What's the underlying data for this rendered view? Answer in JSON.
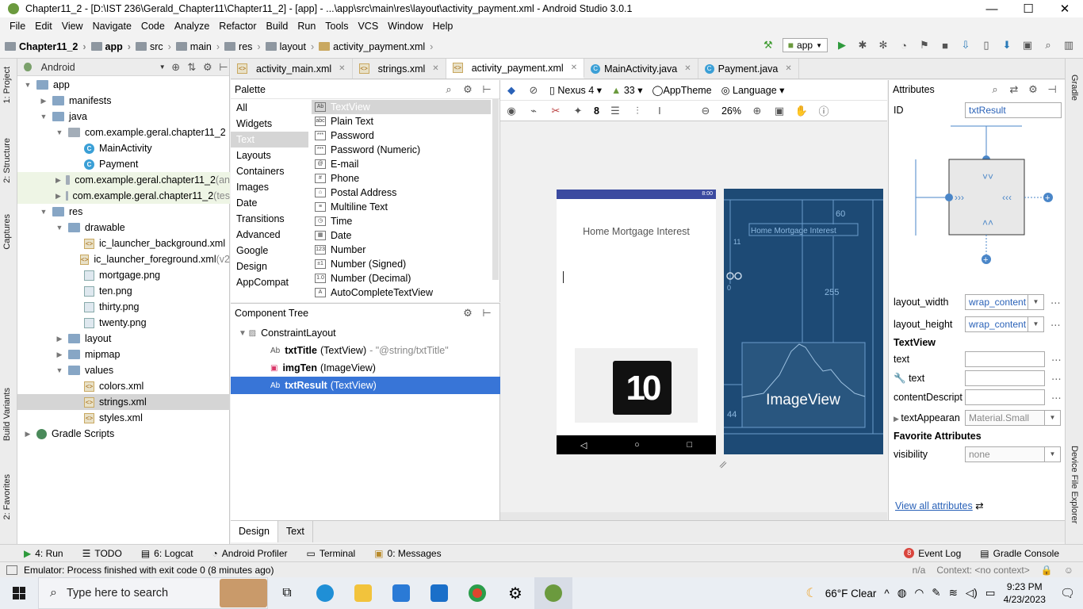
{
  "window": {
    "title": "Chapter11_2 - [D:\\IST 236\\Gerald_Chapter11\\Chapter11_2] - [app] - ...\\app\\src\\main\\res\\layout\\activity_payment.xml - Android Studio 3.0.1",
    "minimize": "—",
    "maximize": "☐",
    "close": "✕"
  },
  "menu": [
    "File",
    "Edit",
    "View",
    "Navigate",
    "Code",
    "Analyze",
    "Refactor",
    "Build",
    "Run",
    "Tools",
    "VCS",
    "Window",
    "Help"
  ],
  "breadcrumbs": [
    "Chapter11_2",
    "app",
    "src",
    "main",
    "res",
    "layout",
    "activity_payment.xml"
  ],
  "run_config": "app",
  "project_panel": {
    "view": "Android",
    "tree": [
      {
        "label": "app",
        "depth": 0,
        "kind": "folder",
        "open": true
      },
      {
        "label": "manifests",
        "depth": 1,
        "kind": "folder",
        "open": false
      },
      {
        "label": "java",
        "depth": 1,
        "kind": "folder",
        "open": true
      },
      {
        "label": "com.example.geral.chapter11_2",
        "depth": 2,
        "kind": "pkg",
        "open": true
      },
      {
        "label": "MainActivity",
        "depth": 3,
        "kind": "class"
      },
      {
        "label": "Payment",
        "depth": 3,
        "kind": "class"
      },
      {
        "label": "com.example.geral.chapter11_2",
        "suffix": " (an",
        "depth": 2,
        "kind": "pkg",
        "open": false
      },
      {
        "label": "com.example.geral.chapter11_2",
        "suffix": " (tes",
        "depth": 2,
        "kind": "pkg",
        "open": false
      },
      {
        "label": "res",
        "depth": 1,
        "kind": "folder",
        "open": true
      },
      {
        "label": "drawable",
        "depth": 2,
        "kind": "folder",
        "open": true
      },
      {
        "label": "ic_launcher_background.xml",
        "depth": 3,
        "kind": "xml"
      },
      {
        "label": "ic_launcher_foreground.xml",
        "suffix": " (v2",
        "depth": 3,
        "kind": "xml"
      },
      {
        "label": "mortgage.png",
        "depth": 3,
        "kind": "png"
      },
      {
        "label": "ten.png",
        "depth": 3,
        "kind": "png"
      },
      {
        "label": "thirty.png",
        "depth": 3,
        "kind": "png"
      },
      {
        "label": "twenty.png",
        "depth": 3,
        "kind": "png"
      },
      {
        "label": "layout",
        "depth": 2,
        "kind": "folder",
        "open": false
      },
      {
        "label": "mipmap",
        "depth": 2,
        "kind": "folder",
        "open": false
      },
      {
        "label": "values",
        "depth": 2,
        "kind": "folder",
        "open": true
      },
      {
        "label": "colors.xml",
        "depth": 3,
        "kind": "xml"
      },
      {
        "label": "strings.xml",
        "depth": 3,
        "kind": "xml",
        "selected": true
      },
      {
        "label": "styles.xml",
        "depth": 3,
        "kind": "xml"
      },
      {
        "label": "Gradle Scripts",
        "depth": 0,
        "kind": "gradle",
        "open": false
      }
    ]
  },
  "left_tabs": [
    "1: Project",
    "2: Structure",
    "Captures",
    "Build Variants",
    "2: Favorites"
  ],
  "right_tabs": [
    "Gradle",
    "Device File Explorer"
  ],
  "editor_tabs": [
    {
      "label": "activity_main.xml",
      "icon": "xml"
    },
    {
      "label": "strings.xml",
      "icon": "xml"
    },
    {
      "label": "activity_payment.xml",
      "icon": "xml",
      "active": true
    },
    {
      "label": "MainActivity.java",
      "icon": "class"
    },
    {
      "label": "Payment.java",
      "icon": "class"
    }
  ],
  "palette": {
    "title": "Palette",
    "categories": [
      "All",
      "Widgets",
      "Text",
      "Layouts",
      "Containers",
      "Images",
      "Date",
      "Transitions",
      "Advanced",
      "Google",
      "Design",
      "AppCompat"
    ],
    "selected_category": "Text",
    "items": [
      {
        "icon": "Ab",
        "label": "TextView"
      },
      {
        "icon": "abc",
        "label": "Plain Text"
      },
      {
        "icon": "***",
        "label": "Password"
      },
      {
        "icon": "***",
        "label": "Password (Numeric)"
      },
      {
        "icon": "@",
        "label": "E-mail"
      },
      {
        "icon": "#",
        "label": "Phone"
      },
      {
        "icon": "⌂",
        "label": "Postal Address"
      },
      {
        "icon": "≡",
        "label": "Multiline Text"
      },
      {
        "icon": "◷",
        "label": "Time"
      },
      {
        "icon": "▦",
        "label": "Date"
      },
      {
        "icon": "123",
        "label": "Number"
      },
      {
        "icon": "±1",
        "label": "Number (Signed)"
      },
      {
        "icon": "1.0",
        "label": "Number (Decimal)"
      },
      {
        "icon": "A",
        "label": "AutoCompleteTextView"
      }
    ]
  },
  "component_tree": {
    "title": "Component Tree",
    "rows": [
      {
        "name": "ConstraintLayout",
        "type": "",
        "hint": "",
        "depth": 0
      },
      {
        "name": "txtTitle",
        "type": "(TextView)",
        "hint": "- \"@string/txtTitle\"",
        "depth": 1
      },
      {
        "name": "imgTen",
        "type": "(ImageView)",
        "hint": "",
        "depth": 1
      },
      {
        "name": "txtResult",
        "type": "(TextView)",
        "hint": "",
        "depth": 1,
        "selected": true
      }
    ]
  },
  "surface_toolbar": {
    "device": "Nexus 4",
    "api": "33",
    "theme": "AppTheme",
    "language": "Language",
    "margin": "8",
    "zoom": "26%"
  },
  "phone": {
    "status_time": "8:00",
    "title_text": "Home Mortgage Interest",
    "image_text": "10"
  },
  "blueprint": {
    "title_text": "Home Mortgage Interest",
    "image_label": "ImageView",
    "dim_60": "60",
    "dim_255": "255",
    "dim_44": "44",
    "dim_11": "11",
    "dim_0": "0"
  },
  "attributes": {
    "title": "Attributes",
    "id_label": "ID",
    "id_value": "txtResult",
    "layout_width_label": "layout_width",
    "layout_width": "wrap_content",
    "layout_height_label": "layout_height",
    "layout_height": "wrap_content",
    "section_textview": "TextView",
    "text_label": "text",
    "text_value": "",
    "text2_label": "text",
    "text2_value": "",
    "content_label": "contentDescript",
    "content_value": "",
    "appearance_label": "textAppearan",
    "appearance_value": "Material.Small",
    "section_fav": "Favorite Attributes",
    "visibility_label": "visibility",
    "visibility_value": "none",
    "view_all": "View all attributes"
  },
  "design_tabs": [
    "Design",
    "Text"
  ],
  "bottom_tools": [
    "4: Run",
    "TODO",
    "6: Logcat",
    "Android Profiler",
    "Terminal",
    "0: Messages"
  ],
  "bottom_right": {
    "event_log_count": "8",
    "event_log": "Event Log",
    "gradle_console": "Gradle Console"
  },
  "status": {
    "message": "Emulator: Process finished with exit code 0 (8 minutes ago)",
    "na": "n/a",
    "context": "Context: <no context>"
  },
  "taskbar": {
    "search_placeholder": "Type here to search",
    "weather": "66°F  Clear",
    "time": "9:23 PM",
    "date": "4/23/2023"
  }
}
